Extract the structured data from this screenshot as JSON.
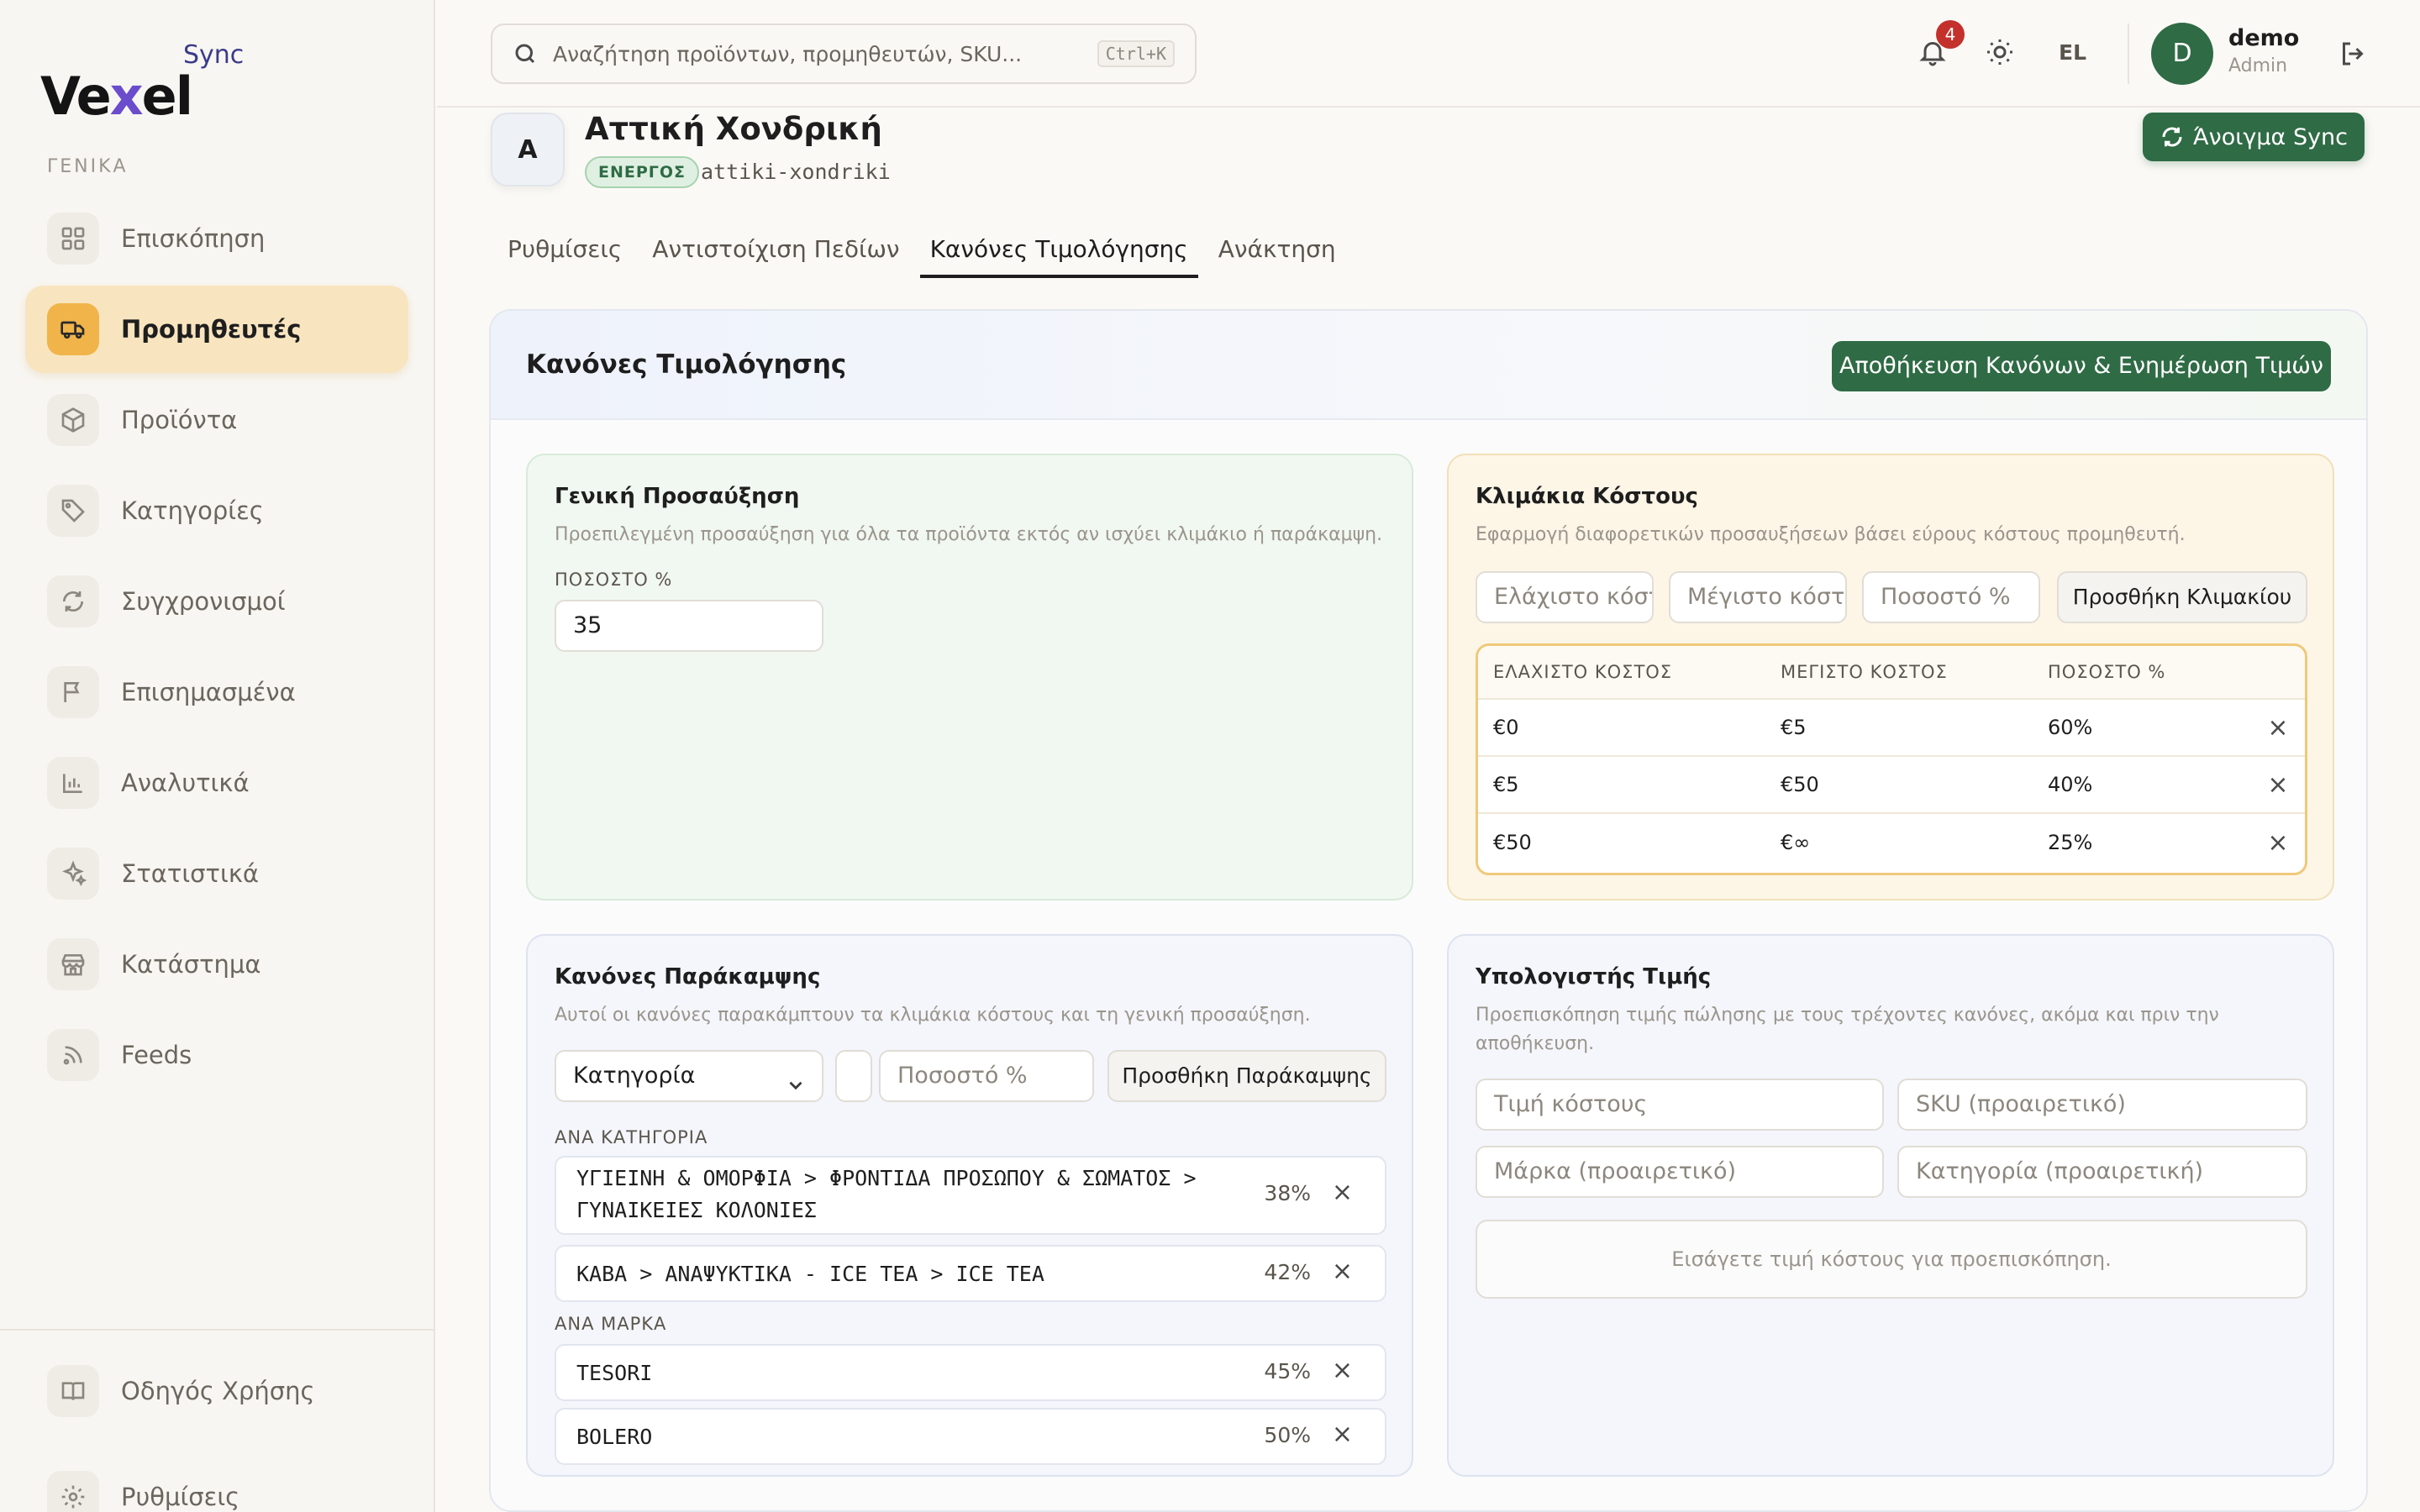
{
  "app": {
    "logo_main_prefix": "Ve",
    "logo_main_x": "x",
    "logo_main_suffix": "el",
    "logo_sync": "Sync"
  },
  "sidebar": {
    "section_label": "ΓΕΝΙΚΑ",
    "items": [
      {
        "label": "Επισκόπηση",
        "icon": "grid-icon"
      },
      {
        "label": "Προμηθευτές",
        "icon": "truck-icon",
        "active": true
      },
      {
        "label": "Προϊόντα",
        "icon": "box-icon"
      },
      {
        "label": "Κατηγορίες",
        "icon": "tag-icon"
      },
      {
        "label": "Συγχρονισμοί",
        "icon": "refresh-icon"
      },
      {
        "label": "Επισημασμένα",
        "icon": "flag-icon"
      },
      {
        "label": "Αναλυτικά",
        "icon": "bar-chart-icon"
      },
      {
        "label": "Στατιστικά",
        "icon": "sparkles-icon"
      },
      {
        "label": "Κατάστημα",
        "icon": "store-icon"
      },
      {
        "label": "Feeds",
        "icon": "rss-icon"
      }
    ],
    "bottom_items": [
      {
        "label": "Οδηγός Χρήσης",
        "icon": "book-icon"
      },
      {
        "label": "Ρυθμίσεις",
        "icon": "gear-icon"
      }
    ]
  },
  "topbar": {
    "search_placeholder": "Αναζήτηση προϊόντων, προμηθευτών, SKU...",
    "search_shortcut": "Ctrl+K",
    "notifications_count": "4",
    "language": "EL",
    "avatar_initial": "D",
    "user_name": "demo",
    "user_role": "Admin"
  },
  "supplier": {
    "logo_initial": "A",
    "name": "Αττική Χονδρική",
    "status": "ΕΝΕΡΓΟΣ",
    "slug": "attiki-xondriki",
    "sync_button": "Άνοιγμα Sync"
  },
  "tabs": [
    "Ρυθμίσεις",
    "Αντιστοίχιση Πεδίων",
    "Κανόνες Τιμολόγησης",
    "Ανάκτηση"
  ],
  "active_tab": "Κανόνες Τιμολόγησης",
  "pricing": {
    "title": "Κανόνες Τιμολόγησης",
    "save_button": "Αποθήκευση Κανόνων & Ενημέρωση Τιμών",
    "general": {
      "title": "Γενική Προσαύξηση",
      "description": "Προεπιλεγμένη προσαύξηση για όλα τα προϊόντα εκτός αν ισχύει κλιμάκιο ή παράκαμψη.",
      "percent_label": "ΠΟΣΟΣΤΟ %",
      "percent_value": "35"
    },
    "tiers": {
      "title": "Κλιμάκια Κόστους",
      "description": "Εφαρμογή διαφορετικών προσαυξήσεων βάσει εύρους κόστους προμηθευτή.",
      "min_placeholder": "Ελάχιστο κόστος",
      "max_placeholder": "Μέγιστο κόστος",
      "pct_placeholder": "Ποσοστό %",
      "add_button": "Προσθήκη Κλιμακίου",
      "columns": [
        "ΕΛΑΧΙΣΤΟ ΚΟΣΤΟΣ",
        "ΜΕΓΙΣΤΟ ΚΟΣΤΟΣ",
        "ΠΟΣΟΣΤΟ %"
      ],
      "rows": [
        {
          "min": "€0",
          "max": "€5",
          "pct": "60%"
        },
        {
          "min": "€5",
          "max": "€50",
          "pct": "40%"
        },
        {
          "min": "€50",
          "max": "€∞",
          "pct": "25%"
        }
      ]
    },
    "overrides": {
      "title": "Κανόνες Παράκαμψης",
      "description": "Αυτοί οι κανόνες παρακάμπτουν τα κλιμάκια κόστους και τη γενική προσαύξηση.",
      "type_selected": "Κατηγορία",
      "value_placeholder": "",
      "pct_placeholder": "Ποσοστό %",
      "add_button": "Προσθήκη Παράκαμψης",
      "by_category_label": "ΑΝΑ ΚΑΤΗΓΟΡΙΑ",
      "by_category": [
        {
          "line1": "ΥΓΙΕΙΝΗ & ΟΜΟΡΦΙΑ > ΦΡΟΝΤΙΔΑ ΠΡΟΣΩΠΟΥ & ΣΩΜΑΤΟΣ >",
          "line2": "ΓΥΝΑΙΚΕΙΕΣ ΚΟΛΟΝΙΕΣ",
          "pct": "38%"
        },
        {
          "line1": "ΚΑΒΑ > ΑΝΑΨΥΚΤΙΚΑ - ICE TEA > ICE TEA",
          "line2": "",
          "pct": "42%"
        }
      ],
      "by_brand_label": "ΑΝΑ ΜΑΡΚΑ",
      "by_brand": [
        {
          "name": "TESORI",
          "pct": "45%"
        },
        {
          "name": "BOLERO",
          "pct": "50%"
        }
      ]
    },
    "calculator": {
      "title": "Υπολογιστής Τιμής",
      "description": "Προεπισκόπηση τιμής πώλησης με τους τρέχοντες κανόνες, ακόμα και πριν την αποθήκευση.",
      "cost_placeholder": "Τιμή κόστους",
      "sku_placeholder": "SKU (προαιρετικό)",
      "brand_placeholder": "Μάρκα (προαιρετικό)",
      "category_placeholder": "Κατηγορία (προαιρετική)",
      "preview_hint": "Εισάγετε τιμή κόστους για προεπισκόπηση."
    }
  },
  "colors": {
    "accent_green": "#2f6b45",
    "active_nav": "#f8e5bf",
    "badge_red": "#c4302b"
  }
}
